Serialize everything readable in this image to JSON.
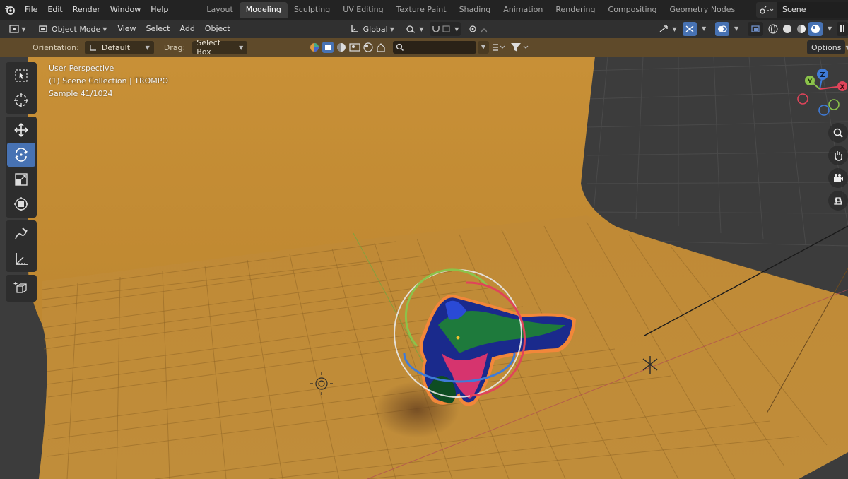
{
  "menu": {
    "items": [
      "File",
      "Edit",
      "Render",
      "Window",
      "Help"
    ]
  },
  "workspaces": {
    "tabs": [
      "Layout",
      "Modeling",
      "Sculpting",
      "UV Editing",
      "Texture Paint",
      "Shading",
      "Animation",
      "Rendering",
      "Compositing",
      "Geometry Nodes"
    ],
    "active": "Modeling"
  },
  "scene": {
    "name": "Scene"
  },
  "header": {
    "mode": "Object Mode",
    "menus": [
      "View",
      "Select",
      "Add",
      "Object"
    ],
    "transform_orientation": "Global"
  },
  "tool_settings": {
    "orientation_label": "Orientation:",
    "orientation_value": "Default",
    "drag_label": "Drag:",
    "drag_value": "Select Box",
    "options_label": "Options"
  },
  "viewport": {
    "perspective": "User Perspective",
    "collection": "(1) Scene Collection | TROMPO",
    "sample": "Sample 41/1024",
    "backdrop_color": "#c78f35",
    "background_color": "#3d3d3d"
  },
  "gizmo": {
    "axes": [
      "X",
      "Y",
      "Z"
    ],
    "colors": {
      "x": "#e0445a",
      "y": "#8bc34a",
      "z": "#3f7bd8"
    }
  },
  "toolbar": {
    "tools": [
      "select-box",
      "cursor",
      "move",
      "rotate",
      "scale",
      "transform",
      "annotate",
      "measure",
      "add-cube"
    ],
    "active": "rotate"
  },
  "colors": {
    "accent": "#4772b3",
    "topbar": "#232323",
    "header": "#303030",
    "tool_settings": "#5f4a2a"
  }
}
